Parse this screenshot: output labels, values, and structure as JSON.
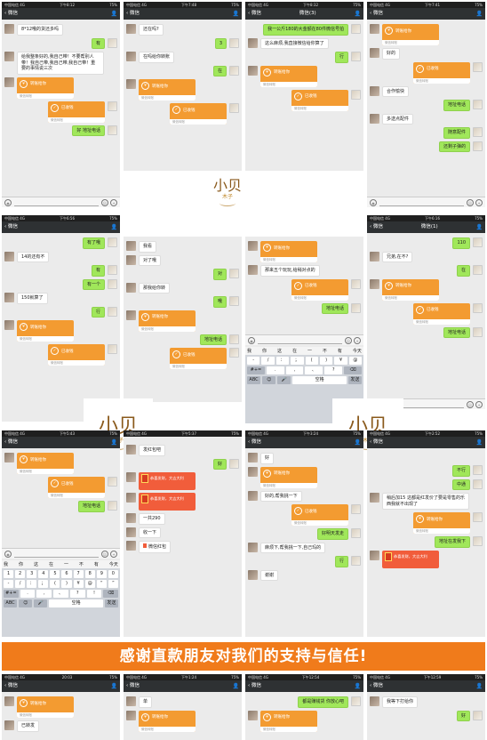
{
  "banner": {
    "text": "感谢直款朋友对我们的支持与信任!"
  },
  "logo": {
    "main": "小贝",
    "sub": "木子"
  },
  "common": {
    "transfer_label": "转账给你",
    "received_label": "已收钱",
    "transfer_foot": "微信转账",
    "red_label": "恭喜发财，大吉大利",
    "red_foot": "微信红包",
    "back": "微信",
    "carrier": "中国电信 4G",
    "battery": "75%",
    "menu_icon": "person-icon"
  },
  "panels": {
    "p1": {
      "time": "下午8:12",
      "title": "",
      "msgs": [
        "8*12哦的货还多吗",
        "有",
        "给我整条好的,我自己带！不要帮别人带！我自己带,我自己带,我自己带！重要的事情说三次",
        "好 地址电话"
      ]
    },
    "p2": {
      "time": "下午7:48",
      "title": "",
      "msgs": [
        "还在吗?",
        "3",
        "在吗给你转账",
        "在"
      ]
    },
    "p3": {
      "time": "下午8:32",
      "title": "微信(3)",
      "msgs": [
        "我一公斤180的大金額在80件微信号拍",
        "这么麻烦,我直接微信给你算了",
        "行"
      ]
    },
    "p4": {
      "time": "下午7:41",
      "title": "",
      "msgs": [
        "好的",
        "合作愉快",
        "地址电话",
        "多送点配件",
        "随意配件",
        "还剩子弹的"
      ]
    },
    "p5": {
      "time": "下午6:56",
      "title": "",
      "msgs": [
        "有了哦",
        "14的还有不",
        "有",
        "有一个",
        "150就算了",
        "行"
      ]
    },
    "p6": {
      "time": "",
      "title": "",
      "msgs": [
        "我看",
        "对了哦",
        "对",
        "那我给你转",
        "哦",
        "地址电话"
      ]
    },
    "p7": {
      "time": "",
      "title": "",
      "msgs": [
        "那来五个玩玩,给稍对点的",
        "地址电话"
      ],
      "candidates": [
        "我",
        "你",
        "这",
        "在",
        "一",
        "不",
        "有",
        "今天"
      ]
    },
    "p8": {
      "time": "下午6:16",
      "title": "微信(1)",
      "msgs": [
        "110",
        "兄弟,在不?",
        "在",
        "地址电话"
      ]
    },
    "p9": {
      "time": "下午5:43",
      "title": "",
      "msgs": [
        "地址电话"
      ],
      "candidates": [
        "我",
        "你",
        "这",
        "在",
        "一",
        "不",
        "有",
        "今天"
      ],
      "keys_r1": [
        "1",
        "2",
        "3",
        "4",
        "5",
        "6",
        "7",
        "8",
        "9",
        "0"
      ],
      "keys_r2": [
        "-",
        "/",
        "：",
        "；",
        "(",
        ")",
        "¥",
        "@",
        "“",
        "”"
      ],
      "keys_r3": [
        "#+=",
        ".",
        ",",
        "、",
        "?",
        "!",
        "."
      ],
      "keys_r4": [
        "ABC",
        "😊",
        "🎤",
        "空格",
        "发送"
      ]
    },
    "p10": {
      "time": "下午5:37",
      "title": "",
      "msgs": [
        "发红包吧",
        "好",
        "一共290",
        "收一下"
      ]
    },
    "p11": {
      "time": "下午3:24",
      "title": "",
      "msgs": [
        "好",
        "好的,帮我挑一下",
        "好明天发走",
        "麻烦下,帮我挑一下,自己玛的",
        "行",
        "谢谢"
      ]
    },
    "p12": {
      "time": "下午2:52",
      "title": "",
      "msgs": [
        "不行",
        "中通",
        "稍后加15 这都是红发价了要是零售的乐西我就不出现了",
        "地址在发我下"
      ]
    },
    "p13": {
      "time": "20:03",
      "title": "",
      "msgs": [
        "已转发"
      ]
    },
    "p14": {
      "time": "下午1:24",
      "title": "",
      "msgs": [
        "单"
      ]
    },
    "p15": {
      "time": "下午12:54",
      "title": "",
      "msgs": [
        "都是赚钱货 你放心吧"
      ]
    },
    "p16": {
      "time": "下午12:59",
      "title": "",
      "msgs": [
        "我等下打给你",
        "好"
      ]
    }
  }
}
